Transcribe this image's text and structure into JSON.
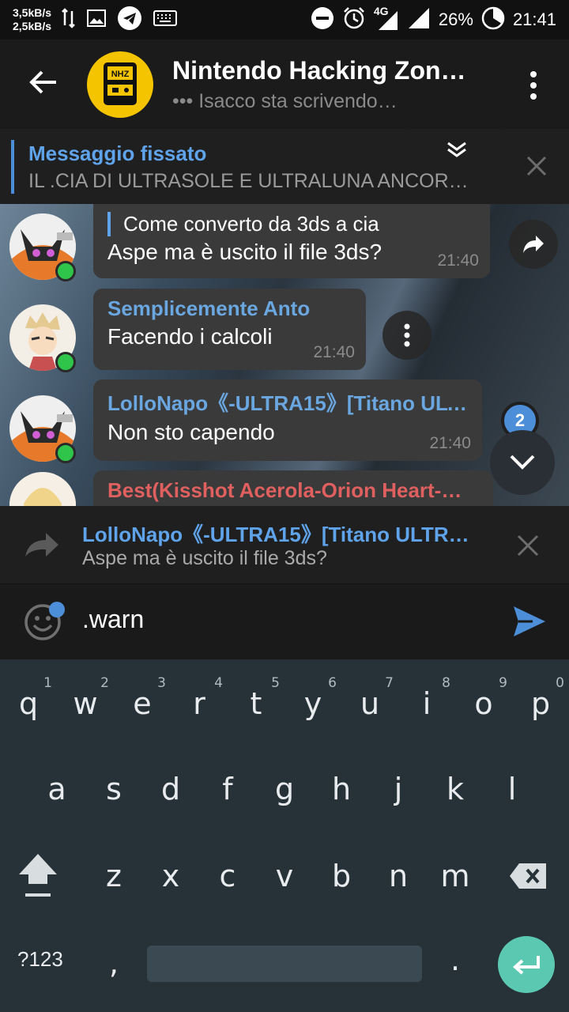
{
  "status_bar": {
    "net_up": "3,5kB/s",
    "net_down": "2,5kB/s",
    "network": "4G",
    "battery": "26%",
    "time": "21:41"
  },
  "header": {
    "title": "Nintendo Hacking Zon…",
    "status": "••• Isacco sta scrivendo…",
    "avatar_text": "NHZ"
  },
  "pinned": {
    "title": "Messaggio fissato",
    "text": "IL .CIA DI ULTRASOLE E ULTRALUNA ANCOR…"
  },
  "messages": [
    {
      "quote": "Come converto da 3ds a cia",
      "text": "Aspe ma è uscito il file 3ds?",
      "time": "21:40"
    },
    {
      "name": "Semplicemente Anto",
      "text": "Facendo i calcoli",
      "time": "21:40"
    },
    {
      "name": "LolloNapo《-ULTRA15》[Titano ULT…",
      "text": "Non sto capendo",
      "time": "21:40"
    },
    {
      "name": "Best(Kisshot Acerola-Orion Heart-…"
    }
  ],
  "unread_badge": "2",
  "reply": {
    "name": "LolloNapo《-ULTRA15》[Titano ULTRA…",
    "text": "Aspe ma è uscito il file 3ds?"
  },
  "input": {
    "value": ".warn"
  },
  "keyboard": {
    "row1": [
      "q",
      "w",
      "e",
      "r",
      "t",
      "y",
      "u",
      "i",
      "o",
      "p"
    ],
    "row1_hints": [
      "1",
      "2",
      "3",
      "4",
      "5",
      "6",
      "7",
      "8",
      "9",
      "0"
    ],
    "row2": [
      "a",
      "s",
      "d",
      "f",
      "g",
      "h",
      "j",
      "k",
      "l"
    ],
    "row3": [
      "z",
      "x",
      "c",
      "v",
      "b",
      "n",
      "m"
    ],
    "symbols_key": "?123",
    "comma": ",",
    "period": "."
  },
  "colors": {
    "accent": "#4c8ed8",
    "online": "#2fc54b",
    "enter_key": "#5bc8b2",
    "name_red": "#e06060"
  }
}
